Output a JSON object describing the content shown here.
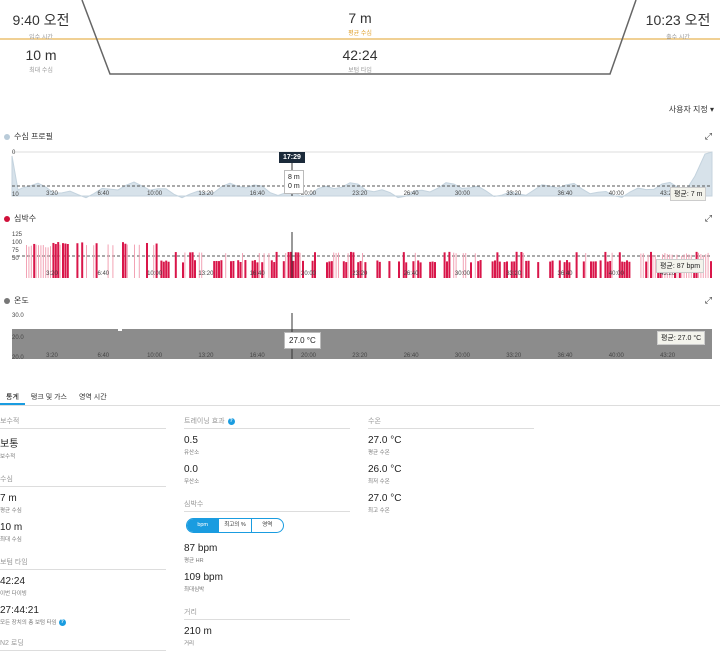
{
  "header": {
    "entry_time": "9:40 오전",
    "entry_time_label": "입수 시간",
    "avg_depth": "7 m",
    "avg_depth_label": "평균 수심",
    "exit_time": "10:23 오전",
    "exit_time_label": "출수 시간",
    "max_depth": "10 m",
    "max_depth_label": "최대 수심",
    "bottom_time": "42:24",
    "bottom_time_label": "보텀 타임"
  },
  "custom_link": "사용자 지정 ▾",
  "depth_chart": {
    "title": "수심 프로필",
    "dot_color": "#b9cbd9",
    "y_top": "0",
    "y_bottom": "10",
    "cursor_time": "17:29",
    "tooltip_line1": "8 m",
    "tooltip_line2": "0 m",
    "avg_label": "평균: 7 m",
    "area_color": "#d7e2ea",
    "expand_icon": "⤢"
  },
  "hr_chart": {
    "title": "심박수",
    "dot_color": "#d0103a",
    "y_ticks": [
      "125",
      "100",
      "75",
      "50"
    ],
    "avg_label": "평균: 87 bpm",
    "bar_color": "#d9164a",
    "expand_icon": "⤢"
  },
  "temp_chart": {
    "title": "온도",
    "dot_color": "#777777",
    "y_top": "30.0",
    "y_mid": "20.0",
    "y_bottom": "20.0",
    "tooltip": "27.0 °C",
    "avg_label": "평균: 27.0 °C",
    "fill_color": "#8c8c8c",
    "expand_icon": "⤢"
  },
  "x_ticks": [
    "3:20",
    "6:40",
    "10:00",
    "13:20",
    "16:40",
    "20:00",
    "23:20",
    "26:40",
    "30:00",
    "33:20",
    "36:40",
    "40:00",
    "43:20"
  ],
  "tabs": [
    "통계",
    "탱크 및 가스",
    "영역 시간"
  ],
  "stats": {
    "conservatism": {
      "head": "보수적",
      "value": "보통",
      "label": "보수적"
    },
    "depth": {
      "head": "수심",
      "items": [
        {
          "value": "7 m",
          "label": "평균 수심"
        },
        {
          "value": "10 m",
          "label": "최대 수심"
        }
      ]
    },
    "bottom_time": {
      "head": "보텀 타임",
      "items": [
        {
          "value": "42:24",
          "label": "이번 다이빙"
        },
        {
          "value": "27:44:21",
          "label": "모든 장치의 총 보텀 타임"
        }
      ]
    },
    "n2_head": "N2 로딩",
    "training_effect": {
      "head": "트레이닝 효과",
      "items": [
        {
          "value": "0.5",
          "label": "유산소"
        },
        {
          "value": "0.0",
          "label": "무산소"
        }
      ]
    },
    "heart_rate": {
      "head": "심박수",
      "toggle": [
        "bpm",
        "최고의 %",
        "영역"
      ],
      "items": [
        {
          "value": "87 bpm",
          "label": "평균 HR"
        },
        {
          "value": "109 bpm",
          "label": "최대심박"
        }
      ]
    },
    "distance": {
      "head": "거리",
      "value": "210 m",
      "label": "거리"
    },
    "water_temp": {
      "head": "수온",
      "items": [
        {
          "value": "27.0 °C",
          "label": "평균 수온"
        },
        {
          "value": "26.0 °C",
          "label": "최저 수온"
        },
        {
          "value": "27.0 °C",
          "label": "최고 수온"
        }
      ]
    }
  }
}
